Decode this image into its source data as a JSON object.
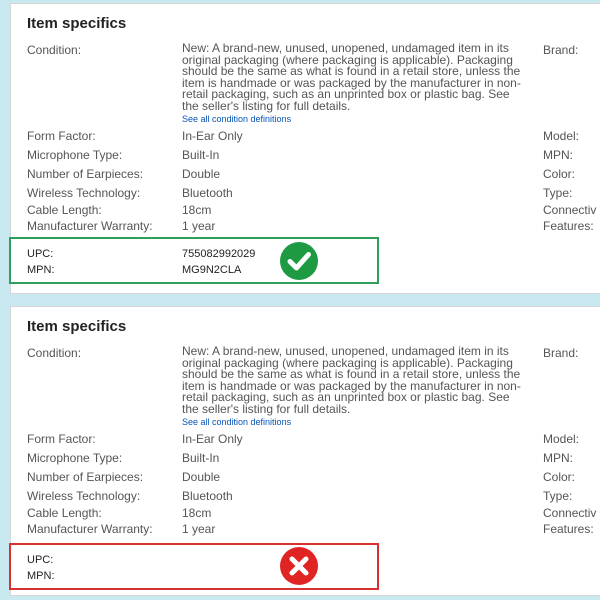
{
  "colors": {
    "background": "#c8e9f0",
    "ok": "#1e9a42",
    "bad": "#e02424",
    "link": "#0654ba"
  },
  "panels": [
    {
      "title": "Item specifics",
      "condition": {
        "label": "Condition:",
        "value": "New: A brand-new, unused, unopened, undamaged item in its original packaging (where packaging is applicable). Packaging should be the same as what is found in a retail store, unless the item is handmade or was packaged by the manufacturer in non-retail packaging, such as an unprinted box or plastic bag. See the seller's listing for full details.",
        "link": "See all condition definitions"
      },
      "specs": [
        {
          "label": "Form Factor:",
          "value": "In-Ear Only"
        },
        {
          "label": "Microphone Type:",
          "value": "Built-In"
        },
        {
          "label": "Number of Earpieces:",
          "value": "Double"
        },
        {
          "label": "Wireless Technology:",
          "value": "Bluetooth"
        },
        {
          "label": "Cable Length:",
          "value": "18cm"
        },
        {
          "label": "Manufacturer Warranty:",
          "value": "1 year"
        }
      ],
      "right_labels": [
        "Brand:",
        "Model:",
        "MPN:",
        "Color:",
        "Type:",
        "Connectiv",
        "Features:"
      ],
      "highlight": {
        "status": "ok",
        "icon": "check-circle-icon",
        "upc_label": "UPC:",
        "upc_value": "755082992029",
        "mpn_label": "MPN:",
        "mpn_value": "MG9N2CLA"
      }
    },
    {
      "title": "Item specifics",
      "condition": {
        "label": "Condition:",
        "value": "New: A brand-new, unused, unopened, undamaged item in its original packaging (where packaging is applicable). Packaging should be the same as what is found in a retail store, unless the item is handmade or was packaged by the manufacturer in non-retail packaging, such as an unprinted box or plastic bag. See the seller's listing for full details.",
        "link": "See all condition definitions"
      },
      "specs": [
        {
          "label": "Form Factor:",
          "value": "In-Ear Only"
        },
        {
          "label": "Microphone Type:",
          "value": "Built-In"
        },
        {
          "label": "Number of Earpieces:",
          "value": "Double"
        },
        {
          "label": "Wireless Technology:",
          "value": "Bluetooth"
        },
        {
          "label": "Cable Length:",
          "value": "18cm"
        },
        {
          "label": "Manufacturer Warranty:",
          "value": "1 year"
        }
      ],
      "right_labels": [
        "Brand:",
        "Model:",
        "MPN:",
        "Color:",
        "Type:",
        "Connectiv",
        "Features:"
      ],
      "highlight": {
        "status": "bad",
        "icon": "x-circle-icon",
        "upc_label": "UPC:",
        "upc_value": "",
        "mpn_label": "MPN:",
        "mpn_value": ""
      }
    }
  ]
}
